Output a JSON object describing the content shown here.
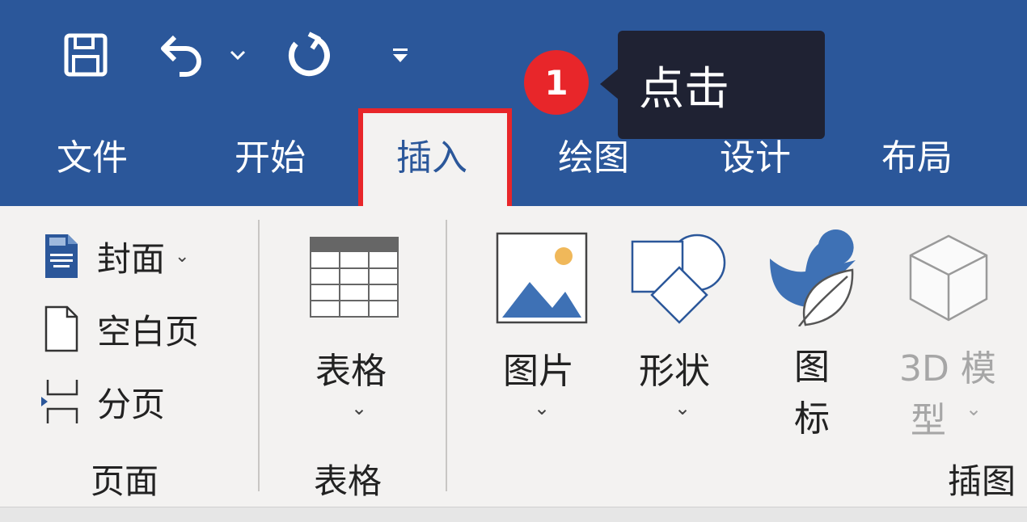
{
  "qat": {
    "save_icon": "save-icon",
    "undo_icon": "undo-icon",
    "undo_dropdown_icon": "chevron-down-icon",
    "redo_icon": "redo-icon",
    "customize_icon": "customize-qat-icon"
  },
  "tabs": [
    {
      "label": "文件"
    },
    {
      "label": "开始"
    },
    {
      "label": "插入",
      "active": true
    },
    {
      "label": "绘图"
    },
    {
      "label": "设计"
    },
    {
      "label": "布局"
    }
  ],
  "annotation": {
    "step_number": "1",
    "callout_text": "点击"
  },
  "groups": {
    "pages": {
      "label": "页面",
      "items": [
        {
          "label": "封面",
          "chevron": "⌄"
        },
        {
          "label": "空白页"
        },
        {
          "label": "分页"
        }
      ]
    },
    "tables": {
      "label": "表格",
      "button_label": "表格",
      "chevron": "⌄"
    },
    "illustrations": {
      "label": "插图",
      "picture_label": "图片",
      "shapes_label": "形状",
      "icons_label_line1": "图",
      "icons_label_line2": "标",
      "model_label_line1": "3D 模",
      "model_label_line2": "型",
      "chevron": "⌄"
    }
  },
  "colors": {
    "title_blue": "#2b579a",
    "highlight_red": "#e8262a",
    "callout_bg": "#1f2233",
    "ribbon_bg": "#f3f2f1"
  }
}
